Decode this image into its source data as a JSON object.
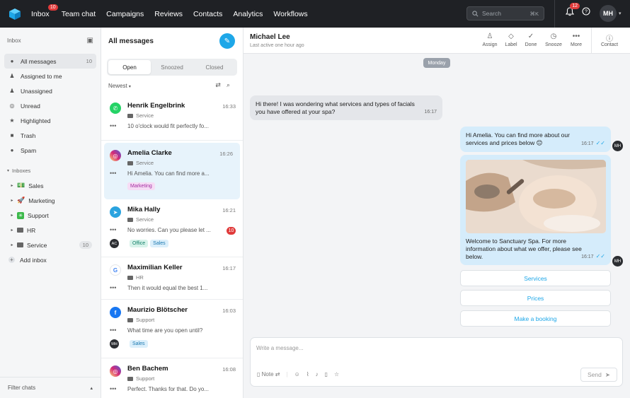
{
  "topnav": {
    "items": [
      {
        "label": "Inbox",
        "badge": "10"
      },
      {
        "label": "Team chat"
      },
      {
        "label": "Campaigns"
      },
      {
        "label": "Reviews"
      },
      {
        "label": "Contacts"
      },
      {
        "label": "Analytics"
      },
      {
        "label": "Workflows"
      }
    ],
    "search_placeholder": "Search",
    "search_shortcut": "⌘K",
    "notifications_badge": "12",
    "user_initials": "MH"
  },
  "sidebar": {
    "header": "Inbox",
    "items": [
      {
        "label": "All messages",
        "count": "10",
        "icon": "chat-icon"
      },
      {
        "label": "Assigned to me",
        "icon": "user-icon"
      },
      {
        "label": "Unassigned",
        "icon": "user-minus-icon"
      },
      {
        "label": "Unread",
        "icon": "eye-off-icon"
      },
      {
        "label": "Highlighted",
        "icon": "star-icon"
      },
      {
        "label": "Trash",
        "icon": "trash-icon"
      },
      {
        "label": "Spam",
        "icon": "alert-icon"
      }
    ],
    "inboxes_label": "Inboxes",
    "inboxes": [
      {
        "label": "Sales",
        "icon": "money-emoji"
      },
      {
        "label": "Marketing",
        "icon": "rocket-emoji"
      },
      {
        "label": "Support",
        "icon": "sparkle-emoji"
      },
      {
        "label": "HR",
        "icon": "folder-icon"
      },
      {
        "label": "Service",
        "icon": "folder-icon",
        "count": "10"
      }
    ],
    "add_inbox": "Add inbox",
    "filter_chats": "Filter chats"
  },
  "list": {
    "title": "All messages",
    "tabs": [
      "Open",
      "Snoozed",
      "Closed"
    ],
    "active_tab": "Open",
    "sort": "Newest",
    "conversations": [
      {
        "name": "Henrik Engelbrink",
        "time": "16:33",
        "inbox": "Service",
        "preview": "10 o'clock would fit perfectly fo...",
        "channel": "whatsapp",
        "color": "#25d366"
      },
      {
        "name": "Amelia Clarke",
        "time": "16:26",
        "inbox": "Service",
        "preview": "Hi Amelia. You can find more a...",
        "channel": "instagram",
        "color": "#d62976",
        "tags": [
          "Marketing"
        ]
      },
      {
        "name": "Mika Hally",
        "time": "16:21",
        "inbox": "Service",
        "preview": "No worries. Can you please let ...",
        "channel": "telegram",
        "color": "#2aa3df",
        "unread": "10",
        "assignee": "AC",
        "tags": [
          "Office",
          "Sales"
        ]
      },
      {
        "name": "Maximilian Keller",
        "time": "16:17",
        "inbox": "HR",
        "preview": "Then it would equal the best 1...",
        "channel": "google",
        "color": "#ffffff"
      },
      {
        "name": "Maurizio Blötscher",
        "time": "16:03",
        "inbox": "Support",
        "preview": "What time are you open until?",
        "channel": "facebook",
        "color": "#1877f2",
        "assignee": "MH",
        "tags": [
          "Sales"
        ]
      },
      {
        "name": "Ben Bachem",
        "time": "16:08",
        "inbox": "Support",
        "preview": "Perfect. Thanks for that. Do yo...",
        "channel": "instagram",
        "color": "#d62976"
      }
    ]
  },
  "chat": {
    "contact_name": "Michael Lee",
    "last_active": "Last active one hour ago",
    "actions": [
      "Assign",
      "Label",
      "Done",
      "Snooze",
      "More",
      "Contact"
    ],
    "day_label": "Monday",
    "messages": [
      {
        "direction": "in",
        "text": "Hi there! I was wondering what services and types of facials you have offered at your spa?",
        "time": "16:17"
      },
      {
        "direction": "out",
        "text": "Hi Amelia. You can find more about our services and prices below 😊",
        "time": "16:17"
      },
      {
        "direction": "out",
        "text": "Welcome to Sanctuary Spa. For more information about what we offer, please see below.",
        "time": "16:17"
      }
    ],
    "agent_initials": "MH",
    "quick_replies": [
      "Services",
      "Prices",
      "Make a booking"
    ],
    "composer_placeholder": "Write a message...",
    "note_label": "Note",
    "send_label": "Send"
  }
}
